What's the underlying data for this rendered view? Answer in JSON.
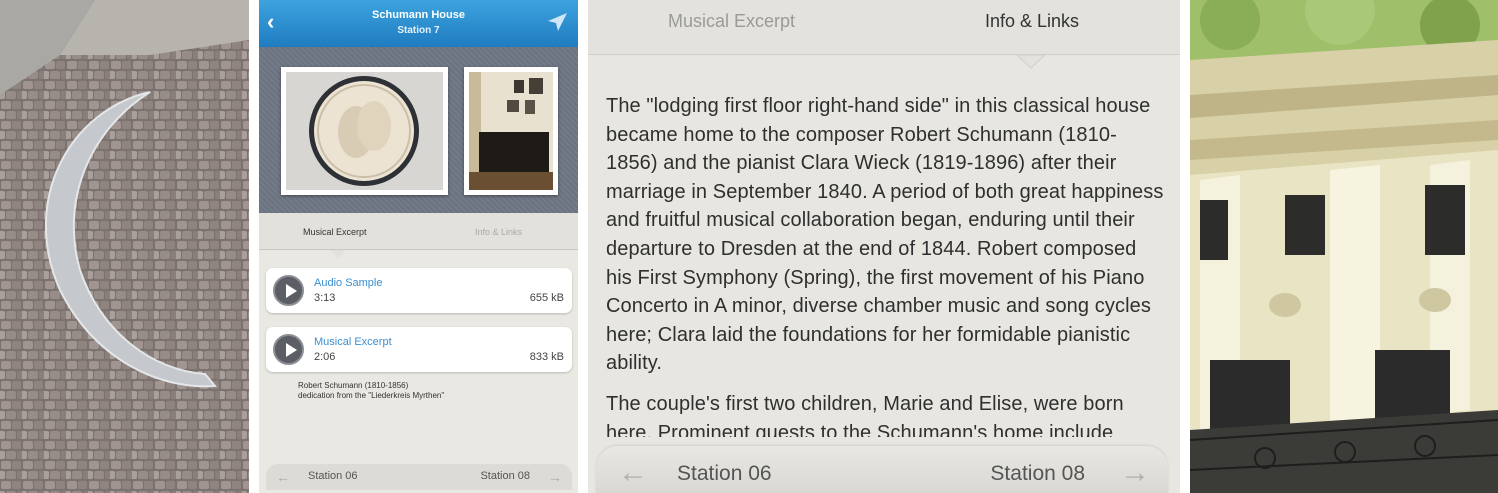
{
  "header": {
    "title": "Schumann House",
    "subtitle": "Station 7",
    "back_icon": "chevron-left-icon",
    "nav_icon": "navigation-arrow-icon"
  },
  "tabs": {
    "active": "Musical Excerpt",
    "inactive": "Info & Links"
  },
  "audio_items": [
    {
      "title": "Audio Sample",
      "duration": "3:13",
      "size": "655 kB"
    },
    {
      "title": "Musical Excerpt",
      "duration": "2:06",
      "size": "833 kB"
    }
  ],
  "caption": {
    "line1": "Robert Schumann (1810-1856)",
    "line2": "dedication from the \"Liederkreis Myrthen\""
  },
  "footer": {
    "prev": "Station 06",
    "next": "Station 08"
  },
  "zoom": {
    "tab_inactive": "Musical Excerpt",
    "tab_active": "Info & Links",
    "paragraph1": "The \"lodging first floor right-hand side\" in this classical house became home to the composer Robert Schumann (1810-1856) and the pianist Clara Wieck (1819-1896) after their marriage in September 1840. A period of both great happiness and fruitful musical collaboration began, enduring until their departure to Dresden at the end of 1844. Robert composed his First Symphony (Spring), the first movement of his Piano Concerto in A minor, diverse chamber music and song cycles here; Clara laid the foundations for her formidable pianistic ability.",
    "paragraph2": "The couple's first two children, Marie and Elise, were born here. Prominent guests to the Schumann's home include",
    "prev": "Station 06",
    "next": "Station 08"
  },
  "colors": {
    "header_blue": "#2b8fd3",
    "link_blue": "#3a8fd1"
  }
}
